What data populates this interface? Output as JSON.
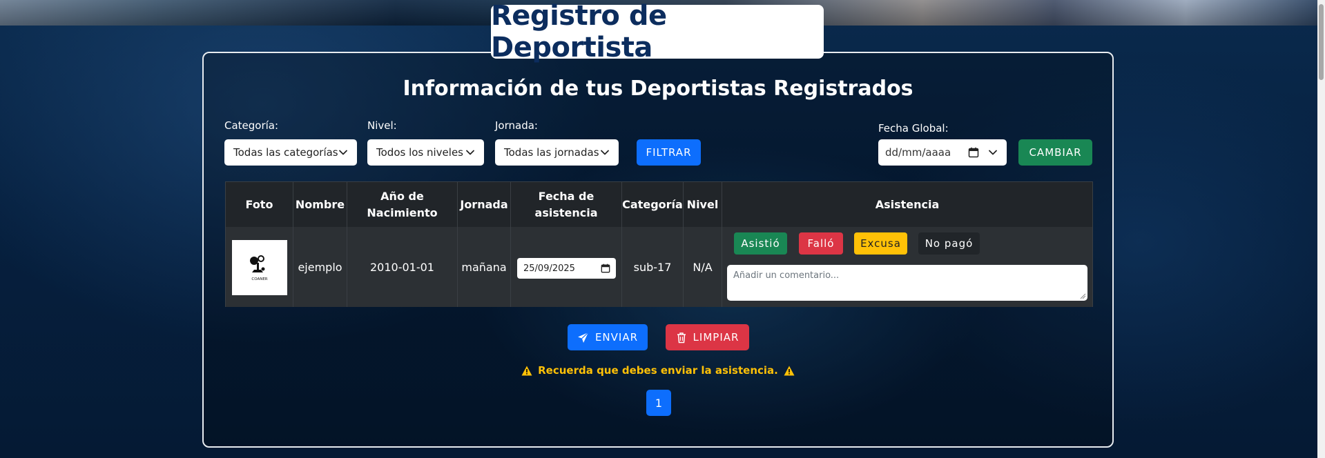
{
  "header": {
    "title": "Registro de Deportista"
  },
  "main": {
    "subtitle": "Información de tus Deportistas Registrados",
    "filters": {
      "category_label": "Categoría:",
      "category_value": "Todas las categorías",
      "level_label": "Nivel:",
      "level_value": "Todos los niveles",
      "shift_label": "Jornada:",
      "shift_value": "Todas las jornadas",
      "filter_button": "Filtrar",
      "global_date_label": "Fecha Global:",
      "global_date_placeholder": "dd/mm/aaaa",
      "change_button": "Cambiar"
    },
    "table": {
      "headers": {
        "photo": "Foto",
        "name": "Nombre",
        "birth_year": "Año de Nacimiento",
        "shift": "Jornada",
        "attendance_date": "Fecha de asistencia",
        "category": "Categoría",
        "level": "Nivel",
        "attendance": "Asistencia"
      },
      "rows": [
        {
          "photo_icon": "coach-logo-icon",
          "photo_caption": "COANER",
          "name": "ejemplo",
          "birth_year": "2010-01-01",
          "shift": "mañana",
          "attendance_date": "25/09/2025",
          "category": "sub-17",
          "level": "N/A",
          "attendance_buttons": {
            "attended": "Asistió",
            "failed": "Falló",
            "excuse": "Excusa",
            "not_paid": "No pagó"
          },
          "comment_placeholder": "Añadir un comentario..."
        }
      ]
    },
    "actions": {
      "send": "Enviar",
      "clear": "Limpiar"
    },
    "warning": "Recuerda que debes enviar la asistencia.",
    "pagination": {
      "current_page": "1"
    }
  },
  "colors": {
    "title_text": "#0c2d5e",
    "primary": "#0d6efd",
    "success": "#198754",
    "danger": "#dc3545",
    "warning": "#ffc107",
    "dark": "#212529"
  }
}
